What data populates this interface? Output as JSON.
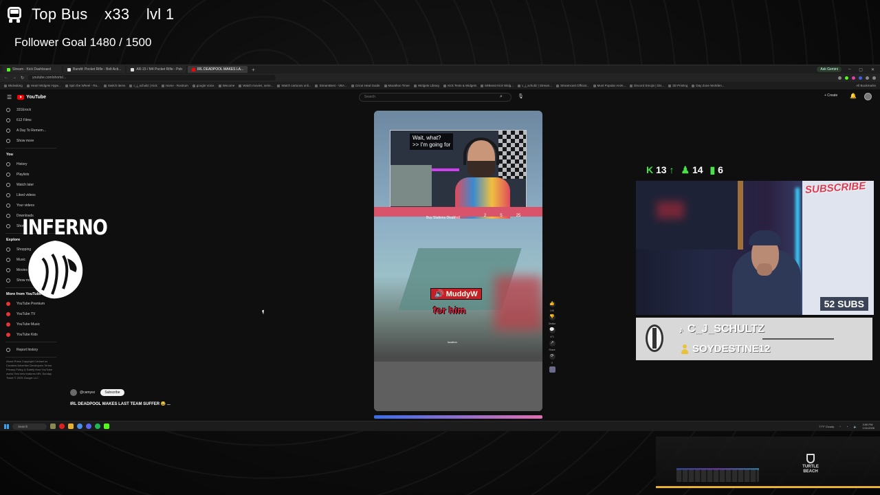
{
  "overlay": {
    "title_parts": [
      "Top Bus",
      "x33",
      "lvl 1"
    ],
    "follower_goal": "Follower Goal 1480 / 1500"
  },
  "browser": {
    "tabs": [
      {
        "label": "Stream - Kick Dashboard",
        "color": "#53fc18"
      },
      {
        "label": "Bandit: Pocket Rifle - Bolt Acti...",
        "color": "#e8e8e8"
      },
      {
        "label": "AR-15 / M4 Pocket Rifle - Peb",
        "color": "#e8e8e8"
      },
      {
        "label": "IRL DEADPOOL MAKES LA...",
        "color": "#ff0000"
      }
    ],
    "gemini": "Ask Gemini",
    "url": "youtube.com/shorts/...",
    "bookmarks": [
      "Bkdvaking",
      "Heart Widgets Hype...",
      "Spin the Wheel - Ra...",
      "Switch Items",
      "c_j_schultz | Kick",
      "Home - Rostrum",
      "google Voice",
      "Wecome",
      "Watch movies, serie...",
      "Watch cartoons onli...",
      "StreamBest - VBA...",
      "Cricut Heat Guide",
      "Marathon Timer",
      "Widgets Library",
      "Kick Texts & Widgets",
      "MrBeast Kick Widg...",
      "c_j_schultz | Stream...",
      "Streamcast Official...",
      "Most Popular Anim...",
      "Discord Emojis | Dis...",
      "3D Printing",
      "Day Zone Worlden..."
    ],
    "bookmarks_all": "All Bookmarks"
  },
  "youtube": {
    "logo": "YouTube",
    "search_placeholder": "Search",
    "create_label": "+ Create",
    "sidebar": {
      "subscriptions": [
        "331Erock",
        "612 Films",
        "A Day To Remem..."
      ],
      "show_more": "Show more",
      "you_header": "You",
      "you_items": [
        "History",
        "Playlists",
        "Watch later",
        "Liked videos",
        "Your videos",
        "Downloads",
        "Shorts"
      ],
      "explore_header": "Explore",
      "explore_items": [
        "Shopping",
        "Music",
        "Movies",
        "Show more"
      ],
      "more_header": "More from YouTube",
      "more_items": [
        "YouTube Premium",
        "YouTube TV",
        "YouTube Music",
        "YouTube Kids"
      ],
      "report": "Report history",
      "footer": "About Press Copyright Contact us Creators Advertise Developers Terms Privacy Policy & Safety How YouTube works Test new features NFL Sunday Ticket © 2025 Google LLC"
    },
    "short": {
      "caption_line1": "Wait, what?",
      "caption_line2": ">> I'm going for",
      "hud_text": "Buy Stations Disabled",
      "hud_nums": [
        "2",
        "5",
        "25"
      ],
      "kill_name": "MuddyW",
      "kill_sub": "for him",
      "small_hud": "location",
      "channel": "@camyez",
      "subscribe": "Subscribe",
      "title": "IRL DEADPOOL MAKES LAST TEAM SUFFER 😂 ...",
      "actions": [
        {
          "icon": "like-icon",
          "glyph": "👍",
          "label": "10K"
        },
        {
          "icon": "dislike-icon",
          "glyph": "👎",
          "label": "Dislike"
        },
        {
          "icon": "comment-icon",
          "glyph": "💬",
          "label": "471"
        },
        {
          "icon": "share-icon",
          "glyph": "↗",
          "label": "Share"
        },
        {
          "icon": "remix-icon",
          "glyph": "⟳",
          "label": "0"
        }
      ]
    }
  },
  "taskbar": {
    "search": "Search",
    "weather": "77°F Cloudy",
    "time": "3:59 PM",
    "date": "1/11/2026"
  },
  "stream_overlay": {
    "kick_count": "13",
    "follower_count": "14",
    "viewer_count": "6",
    "subs_badge": "52 SUBS",
    "tiktok_handle": "C_J_SCHULTZ",
    "username": "SOYDESTINE12",
    "board_sub": "SUBSCRIBE",
    "inferno": "INFERNO",
    "turtle_beach": "TURTLE BEACH"
  }
}
